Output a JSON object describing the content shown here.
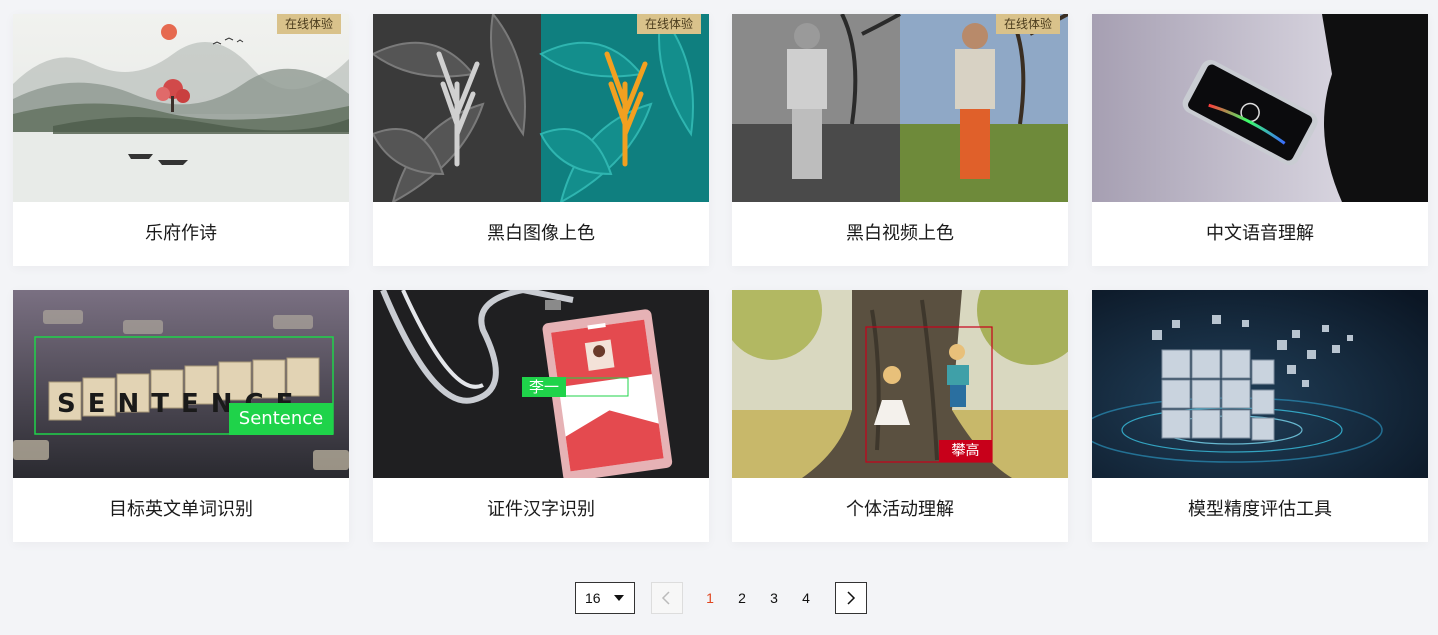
{
  "badge_label": "在线体验",
  "cards": [
    {
      "title": "乐府作诗",
      "badge": true
    },
    {
      "title": "黑白图像上色",
      "badge": true
    },
    {
      "title": "黑白视频上色",
      "badge": true
    },
    {
      "title": "中文语音理解",
      "badge": false
    },
    {
      "title": "目标英文单词识别",
      "badge": false
    },
    {
      "title": "证件汉字识别",
      "badge": false
    },
    {
      "title": "个体活动理解",
      "badge": false
    },
    {
      "title": "模型精度评估工具",
      "badge": false
    }
  ],
  "overlays": {
    "sentence_tiles": "SENTENCE",
    "sentence_label": "Sentence",
    "id_name_label": "李一",
    "climb_label": "攀高"
  },
  "pagination": {
    "page_size": "16",
    "pages": [
      "1",
      "2",
      "3",
      "4"
    ],
    "current": "1"
  },
  "colors": {
    "badge_bg": "#d9c28b",
    "active_page": "#e0461f",
    "detect_green": "#1fd34a",
    "detect_red": "#c8001a"
  }
}
